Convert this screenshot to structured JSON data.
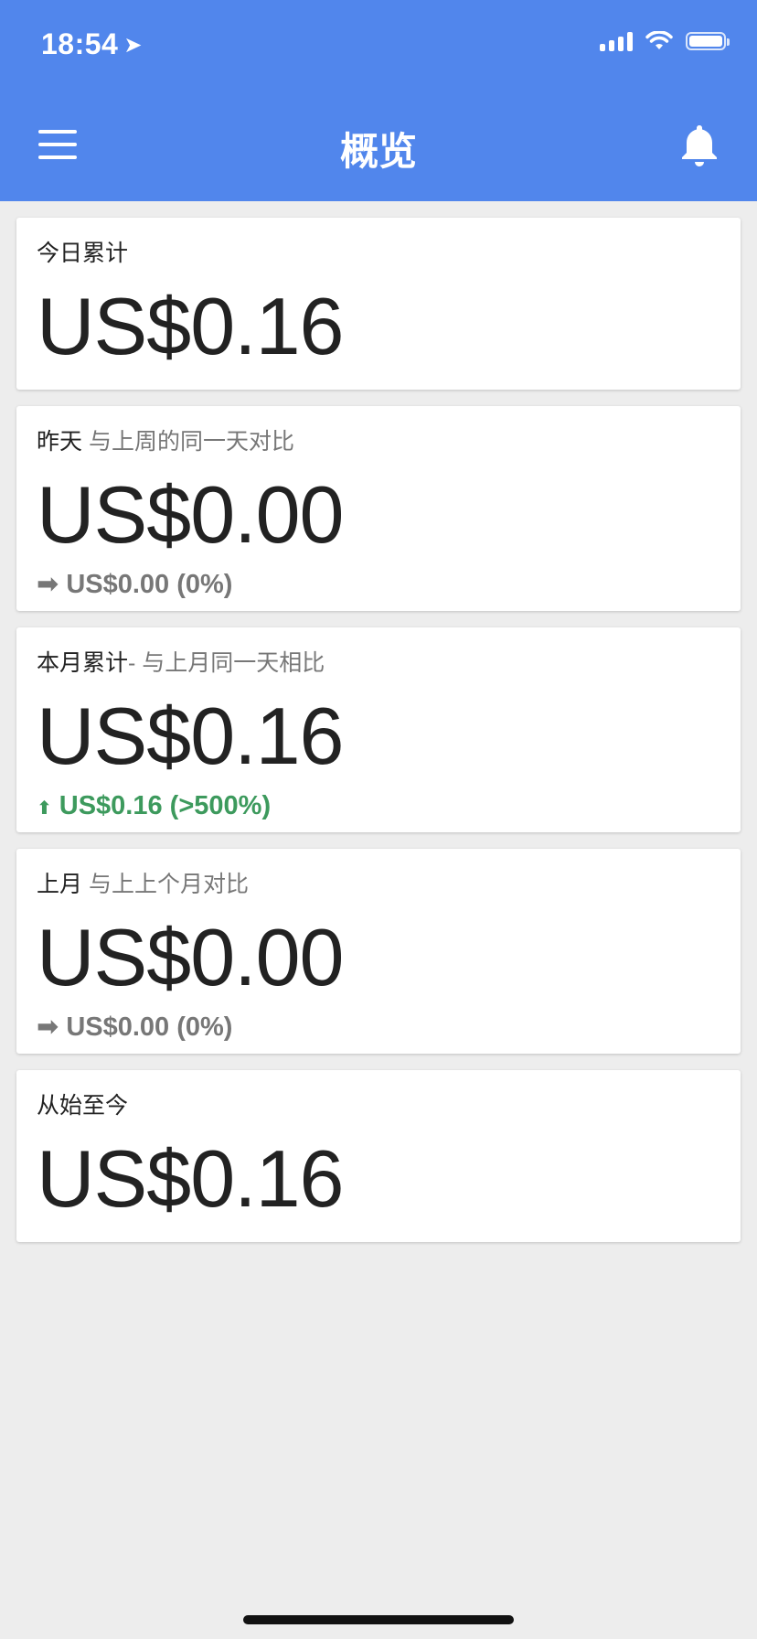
{
  "status_bar": {
    "time": "18:54",
    "location_icon": "location-arrow-icon",
    "signal_icon": "cellular-signal-icon",
    "wifi_icon": "wifi-icon",
    "battery_icon": "battery-icon"
  },
  "header": {
    "title": "概览",
    "menu_icon": "hamburger-menu-icon",
    "bell_icon": "bell-icon",
    "background": "#5186ec"
  },
  "cards": [
    {
      "label": "今日累计",
      "sublabel": "",
      "amount": "US$0.16"
    },
    {
      "label": "昨天",
      "sublabel": " 与上周的同一天对比",
      "amount": "US$0.00",
      "change_icon": "➡",
      "change": "US$0.00 (0%)"
    },
    {
      "label": "本月累计",
      "sublabel": "- 与上月同一天相比",
      "amount": "US$0.16",
      "change_icon": "⬆",
      "change": "US$0.16 (>500%)",
      "change_color": "#3d9a5d"
    },
    {
      "label": "上月",
      "sublabel": " 与上上个月对比",
      "amount": "US$0.00",
      "change_icon": "➡",
      "change": "US$0.00 (0%)"
    },
    {
      "label": "从始至今",
      "sublabel": "",
      "amount": "US$0.16"
    }
  ]
}
